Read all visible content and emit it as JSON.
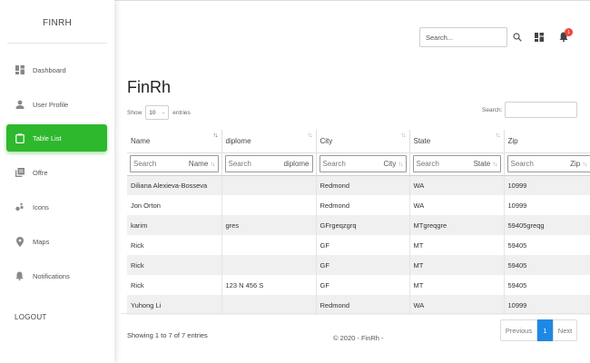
{
  "app": {
    "brand": "FINRH"
  },
  "sidebar": {
    "items": [
      {
        "label": "Dashboard",
        "icon": "dashboard-icon"
      },
      {
        "label": "User Profile",
        "icon": "person-icon"
      },
      {
        "label": "Table List",
        "icon": "clipboard-icon",
        "active": true
      },
      {
        "label": "Offre",
        "icon": "library-books-icon"
      },
      {
        "label": "Icons",
        "icon": "bubble-chart-icon"
      },
      {
        "label": "Maps",
        "icon": "location-pin-icon"
      },
      {
        "label": "Notifications",
        "icon": "bell-icon"
      }
    ],
    "logout": "LOGOUT",
    "accent": "#2eb82e"
  },
  "header": {
    "search_placeholder": "Search...",
    "notification_count": "1"
  },
  "main": {
    "title": "FinRh",
    "length": {
      "show": "Show",
      "value": "10",
      "entries": "entries"
    },
    "search_label": "Search:",
    "table": {
      "columns": [
        "Name",
        "diplome",
        "City",
        "State",
        "Zip"
      ],
      "filters": [
        {
          "hint": "Search",
          "label": "Name"
        },
        {
          "hint": "Search",
          "label": "diplome"
        },
        {
          "hint": "Search",
          "label": "City"
        },
        {
          "hint": "Search",
          "label": "State"
        },
        {
          "hint": "Search",
          "label": "Zip"
        }
      ],
      "rows": [
        [
          "Diliana Alexieva-Bosseva",
          "",
          "Redmond",
          "WA",
          "10999"
        ],
        [
          "Jon Orton",
          "",
          "Redmond",
          "WA",
          "10999"
        ],
        [
          "karim",
          "gres",
          "GFrgeqzgrq",
          "MTgreqgre",
          "59405greqg"
        ],
        [
          "Rick",
          "",
          "GF",
          "MT",
          "59405"
        ],
        [
          "Rick",
          "",
          "GF",
          "MT",
          "59405"
        ],
        [
          "Rick",
          "123 N 456 S",
          "GF",
          "MT",
          "59405"
        ],
        [
          "Yuhong Li",
          "",
          "Redmond",
          "WA",
          "10999"
        ]
      ]
    },
    "info": "Showing 1 to 7 of 7 entries",
    "copyright": "© 2020 - FinRh -",
    "pagination": {
      "previous": "Previous",
      "page": "1",
      "next": "Next",
      "active_color": "#1e88e5"
    }
  }
}
